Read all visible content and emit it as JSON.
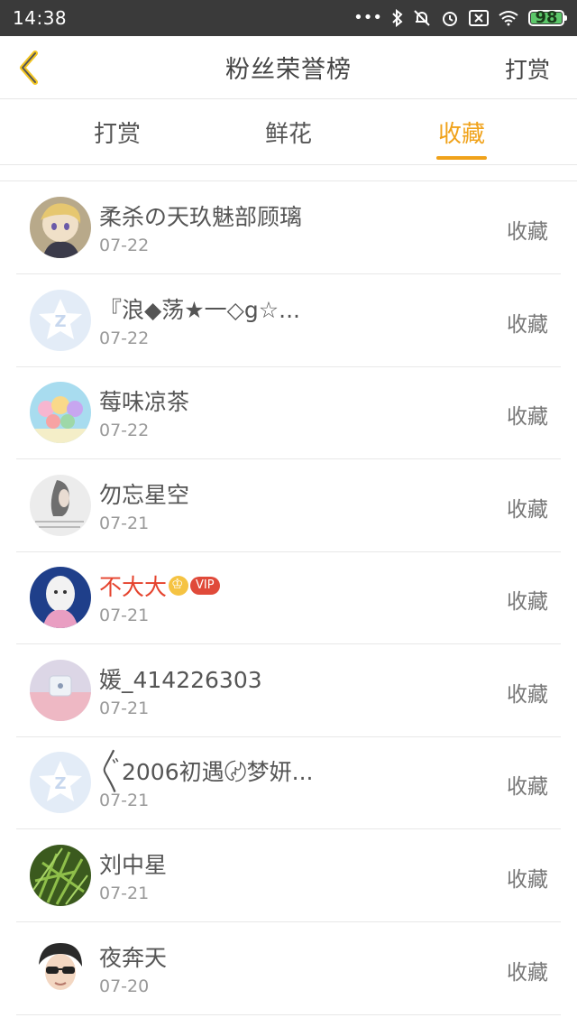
{
  "status_bar": {
    "time": "14:38",
    "battery": "98",
    "icons": [
      "more-dots-icon",
      "bluetooth-icon",
      "mute-icon",
      "alarm-icon",
      "sim-icon",
      "wifi-icon",
      "battery-icon"
    ]
  },
  "header": {
    "title": "粉丝荣誉榜",
    "action": "打赏"
  },
  "tabs": [
    {
      "label": "打赏",
      "active": false
    },
    {
      "label": "鲜花",
      "active": false
    },
    {
      "label": "收藏",
      "active": true
    }
  ],
  "accent_color": "#f0a21a",
  "vip_name_color": "#e5432d",
  "fans": [
    {
      "name": "柔杀の天玖魅部顾璃",
      "date": "07-22",
      "action": "收藏"
    },
    {
      "name": "『浪◆荡★一◇g☆...",
      "date": "07-22",
      "action": "收藏"
    },
    {
      "name": "莓味凉茶",
      "date": "07-22",
      "action": "收藏"
    },
    {
      "name": "勿忘星空",
      "date": "07-21",
      "action": "收藏"
    },
    {
      "name": "不大大",
      "date": "07-21",
      "action": "收藏",
      "vip_label": "VIP"
    },
    {
      "name": "媛_414226303",
      "date": "07-21",
      "action": "收藏"
    },
    {
      "name": "〲2006初遇〄梦妍...",
      "date": "07-21",
      "action": "收藏"
    },
    {
      "name": "刘中星",
      "date": "07-21",
      "action": "收藏"
    },
    {
      "name": "夜奔天",
      "date": "07-20",
      "action": "收藏"
    }
  ]
}
